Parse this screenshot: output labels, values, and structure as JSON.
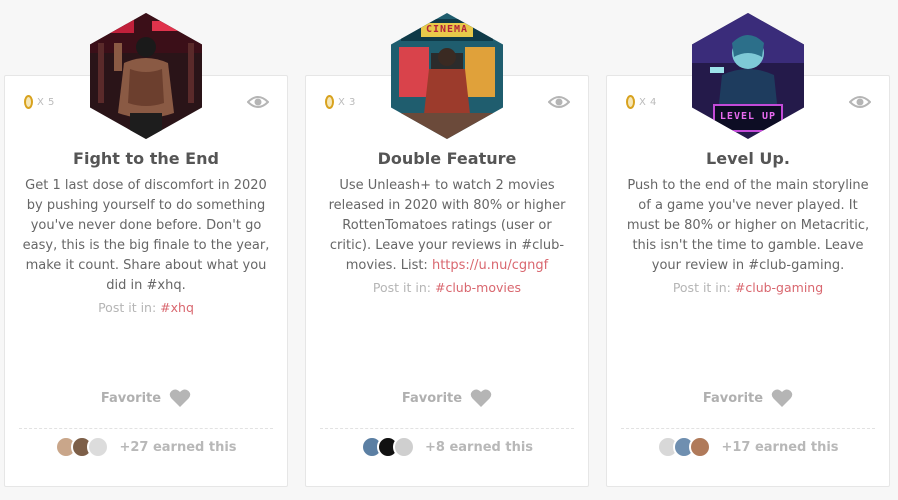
{
  "cards": [
    {
      "badge_text": "",
      "points": "X 5",
      "title": "Fight to the End",
      "description": "Get 1 last dose of discomfort in 2020 by pushing yourself to do something you've never done before. Don't go easy, this is the big finale to the year, make it count. Share about what you did in #xhq.",
      "link": "",
      "post_prefix": "Post it in: ",
      "post_channel": "#xhq",
      "favorite_label": "Favorite",
      "earned_label": "+27 earned this",
      "icons": [
        "coin-icon",
        "eye-icon",
        "heart-icon"
      ]
    },
    {
      "badge_text": "CINEMA",
      "points": "X 3",
      "title": "Double Feature",
      "description": "Use Unleash+ to watch 2 movies released in 2020 with 80% or higher RottenTomatoes ratings (user or critic). Leave your reviews in #club-movies. List: ",
      "link": "https://u.nu/cgngf",
      "post_prefix": "Post it in: ",
      "post_channel": "#club-movies",
      "favorite_label": "Favorite",
      "earned_label": "+8 earned this",
      "icons": [
        "coin-icon",
        "eye-icon",
        "heart-icon"
      ]
    },
    {
      "badge_text": "LEVEL UP",
      "points": "X 4",
      "title": "Level Up.",
      "description": "Push to the end of the main storyline of a game you've never played. It must be 80% or higher on Metacritic, this isn't the time to gamble. Leave your review in #club-gaming.",
      "link": "",
      "post_prefix": "Post it in: ",
      "post_channel": "#club-gaming",
      "favorite_label": "Favorite",
      "earned_label": "+17 earned this",
      "icons": [
        "coin-icon",
        "eye-icon",
        "heart-icon"
      ]
    }
  ],
  "colors": {
    "accent_link": "#d9676f",
    "title_text": "#555555",
    "muted_text": "#b5b5b5",
    "coin": "#d8a21e"
  }
}
